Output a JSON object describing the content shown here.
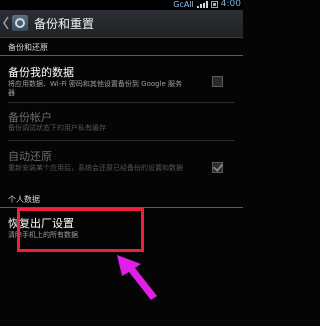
{
  "statusbar": {
    "network": "GcAll",
    "time": "4:00"
  },
  "header": {
    "title": "备份和重置"
  },
  "sections": {
    "backup": {
      "header": "备份和还原"
    },
    "personal": {
      "header": "个人数据"
    }
  },
  "prefs": {
    "backup_data": {
      "title": "备份我的数据",
      "summary": "将应用数据、Wi-Fi 密码和其他设置备份到 Google 服务器",
      "checked": false,
      "enabled": true
    },
    "backup_account": {
      "title": "备份帐户",
      "summary": "备份调试状态下的用户私有缓存",
      "enabled": false
    },
    "auto_restore": {
      "title": "自动还原",
      "summary": "重新安装某个应用后，系统会还原已经备份的设置和数据",
      "checked": true,
      "enabled": false
    },
    "factory_reset": {
      "title": "恢复出厂设置",
      "summary": "清除手机上的所有数据",
      "enabled": true
    }
  },
  "annotation": {
    "highlight_color": "#f0203c",
    "arrow_color": "#e020e8"
  }
}
